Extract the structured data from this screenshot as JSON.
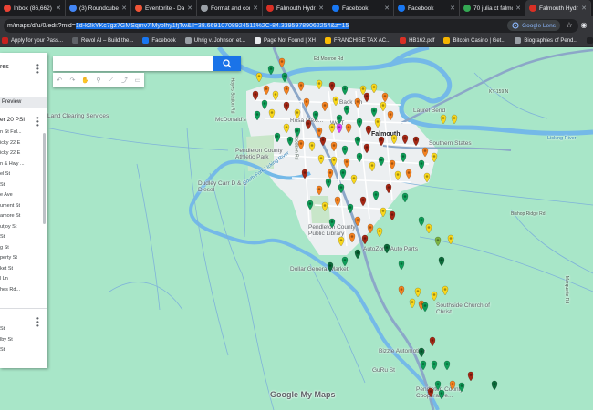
{
  "browser": {
    "tabs": [
      {
        "title": "Inbox (86,662) - ...",
        "color": "#ea4335"
      },
      {
        "title": "(3) Roundcube Wi...",
        "color": "#4285f4"
      },
      {
        "title": "Eventbrite - Dash...",
        "color": "#f05537"
      },
      {
        "title": "Format and conve...",
        "color": "#9aa0a6"
      },
      {
        "title": "Falmouth Hydran...",
        "color": "#d93025"
      },
      {
        "title": "Facebook",
        "color": "#1877f2"
      },
      {
        "title": "Facebook",
        "color": "#1877f2"
      },
      {
        "title": "70 julia ct falmout...",
        "color": "#34a853"
      },
      {
        "title": "Falmouth Hydran...",
        "color": "#d93025",
        "active": true
      }
    ],
    "url_prefix": "m/maps/d/u/0/edit?mid=",
    "url_rest": "1d-k2kYKc7gz7GMSqmv7lMyolhy1fjTw&ll=38.66910708924511%2C-84.33959789062254&z=15",
    "google_lens_label": "Google Lens",
    "bookmarks": [
      {
        "label": "Apply for your Pass...",
        "color": "#c5221f"
      },
      {
        "label": "Revol AI – Build the...",
        "color": "#5f6368"
      },
      {
        "label": "Facebook",
        "color": "#1877f2"
      },
      {
        "label": "Uhrig v. Johnson et...",
        "color": "#9aa0a6"
      },
      {
        "label": "Page Not Found | XH",
        "color": "#e8eaed"
      },
      {
        "label": "FRANCHISE TAX AC...",
        "color": "#fbbc04"
      },
      {
        "label": "HB162.pdf",
        "color": "#d93025"
      },
      {
        "label": "Bitcoin Casino | Get...",
        "color": "#f4b400"
      },
      {
        "label": "Biographies of Pend...",
        "color": "#9aa0a6"
      },
      {
        "label": "LOOKING BACK | pu...",
        "color": "#202124"
      }
    ]
  },
  "panel": {
    "title": "res",
    "preview_label": "Preview",
    "layer_title": "er 20 PSI",
    "items": [
      "n St Fal...",
      "icky 22 E",
      "icky 22 E",
      "n & Hwy ...",
      "el St",
      "St",
      "e Ave",
      "ument St",
      "amore St",
      "utjoy St",
      "St",
      "g St",
      "perty St",
      "ket St",
      "l Ln",
      "hes Rd..."
    ],
    "items2": [
      "St",
      "lby St",
      "St"
    ]
  },
  "search": {
    "placeholder": ""
  },
  "map": {
    "attribution": "Google My Maps",
    "labels": [
      {
        "text": "Land Clearing Services",
        "cls": "poi-label"
      },
      {
        "text": "McDonald's",
        "cls": "poi-label"
      },
      {
        "text": "Pendleton County Athletic Park",
        "cls": "poi-label"
      },
      {
        "text": "Dudley Carr D & C Diesel",
        "cls": "poi-label"
      },
      {
        "text": "Falmouth",
        "cls": "place-label"
      },
      {
        "text": "Southern States",
        "cls": "poi-label"
      },
      {
        "text": "Laurel Bend",
        "cls": "poi-label"
      },
      {
        "text": "Pendleton County Public Library",
        "cls": "poi-label"
      },
      {
        "text": "AutoZone Auto Parts",
        "cls": "poi-label"
      },
      {
        "text": "Dollar General Market",
        "cls": "poi-label"
      },
      {
        "text": "Southside Church of Christ",
        "cls": "poi-label"
      },
      {
        "text": "Bizzle Automotive",
        "cls": "poi-label"
      },
      {
        "text": "GuRu St",
        "cls": "poi-label"
      },
      {
        "text": "Pendleton County Cooperative...",
        "cls": "poi-label"
      },
      {
        "text": "Licking River",
        "cls": "river-label"
      },
      {
        "text": "South Fork Licking River",
        "cls": "river-label"
      },
      {
        "text": "Ed Monroe Rd",
        "cls": "road-label"
      },
      {
        "text": "KY-159 N",
        "cls": "road-label"
      },
      {
        "text": "Bishop Ridge Rd",
        "cls": "road-label"
      },
      {
        "text": "Marquette Rd",
        "cls": "road-label"
      },
      {
        "text": "Hayes Station Rd",
        "cls": "road-label"
      },
      {
        "text": "Woodson Rd",
        "cls": "road-label"
      },
      {
        "text": "Back Inn",
        "cls": "poi-label"
      },
      {
        "text": "Rosa Mexi...",
        "cls": "poi-label"
      },
      {
        "text": "We T",
        "cls": "poi-label"
      }
    ],
    "pin_colors": {
      "red": "#a52714",
      "orange": "#f4811f",
      "yellow": "#f9d71c",
      "green": "#0f9d58",
      "darkgreen": "#0b6b3a",
      "lightgreen": "#7cb342",
      "magenta": "#e040fb"
    }
  }
}
